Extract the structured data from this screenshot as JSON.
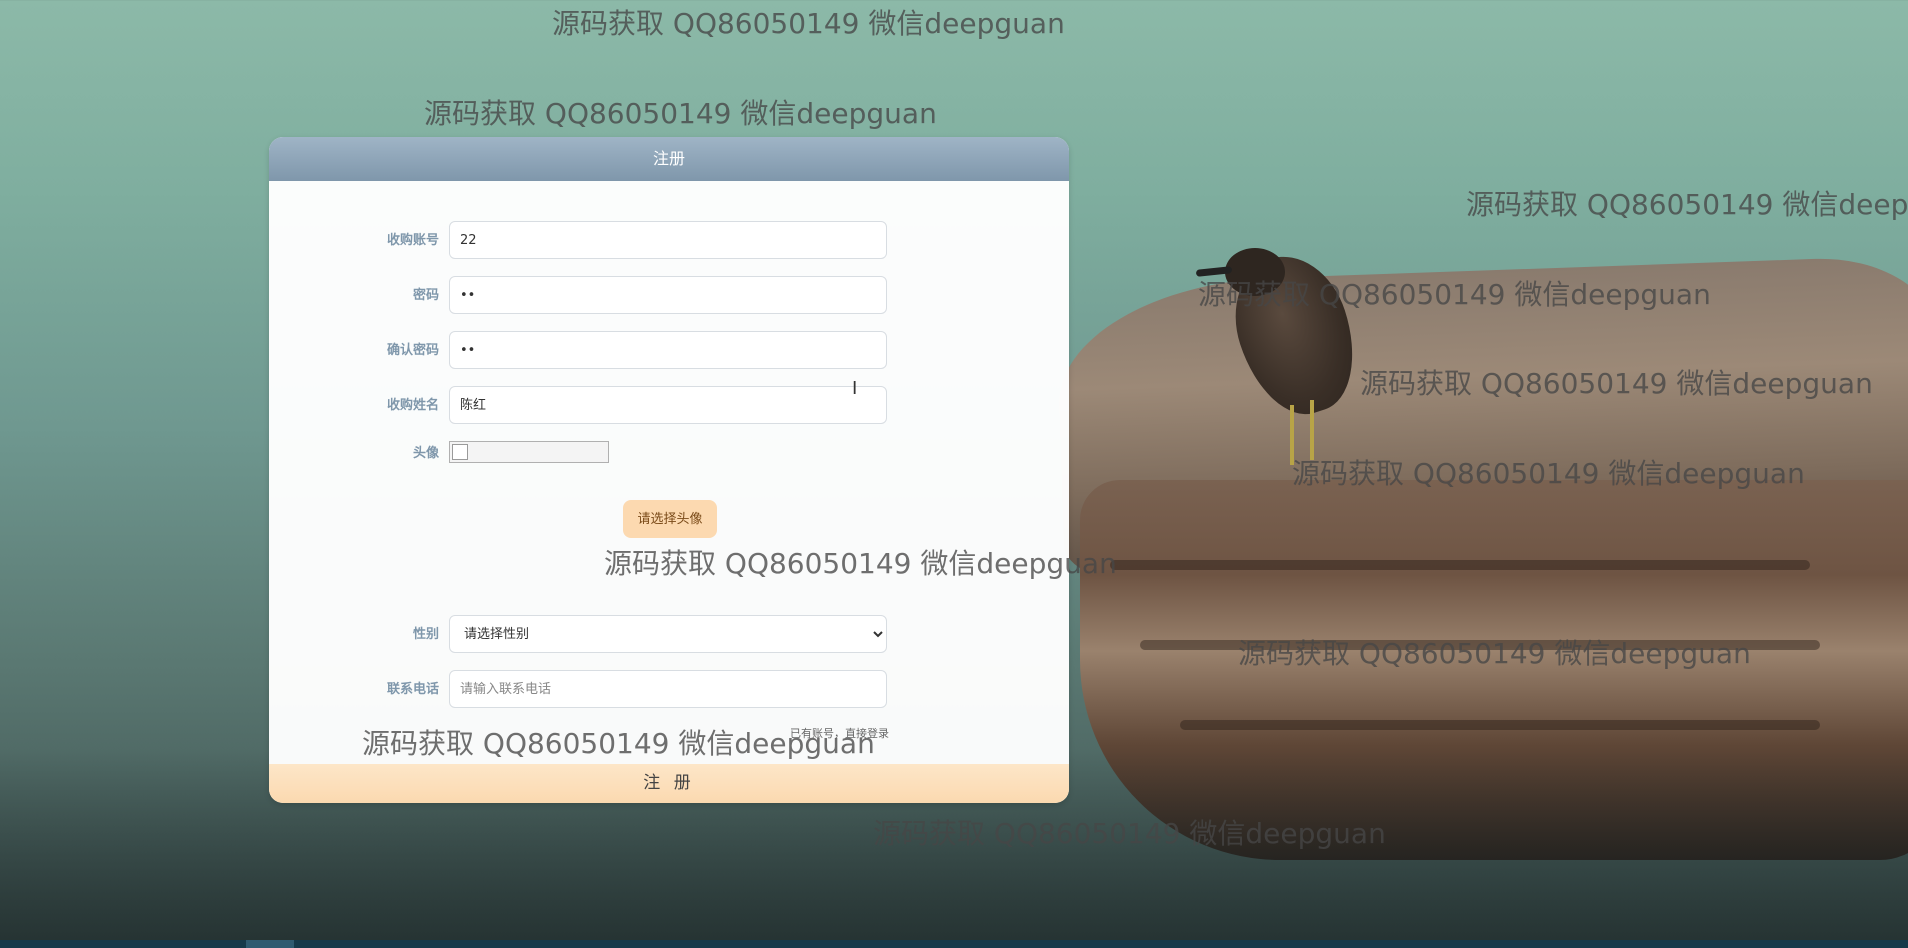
{
  "form": {
    "title": "注册",
    "fields": {
      "account": {
        "label": "收购账号",
        "value": "22"
      },
      "password": {
        "label": "密码",
        "value": "••"
      },
      "confirm": {
        "label": "确认密码",
        "value": "••"
      },
      "name": {
        "label": "收购姓名",
        "value": "陈红"
      },
      "avatar": {
        "label": "头像",
        "button": "请选择头像"
      },
      "gender": {
        "label": "性别",
        "selected": "请选择性别",
        "options": [
          "请选择性别"
        ]
      },
      "phone": {
        "label": "联系电话",
        "placeholder": "请输入联系电话"
      }
    },
    "login_link": "已有账号，直接登录",
    "submit": "注 册"
  },
  "watermark": {
    "text": "源码获取 QQ86050149 微信deepguan"
  },
  "icons": {
    "cursor": "text-cursor-icon",
    "broken_image": "broken-image-icon"
  }
}
